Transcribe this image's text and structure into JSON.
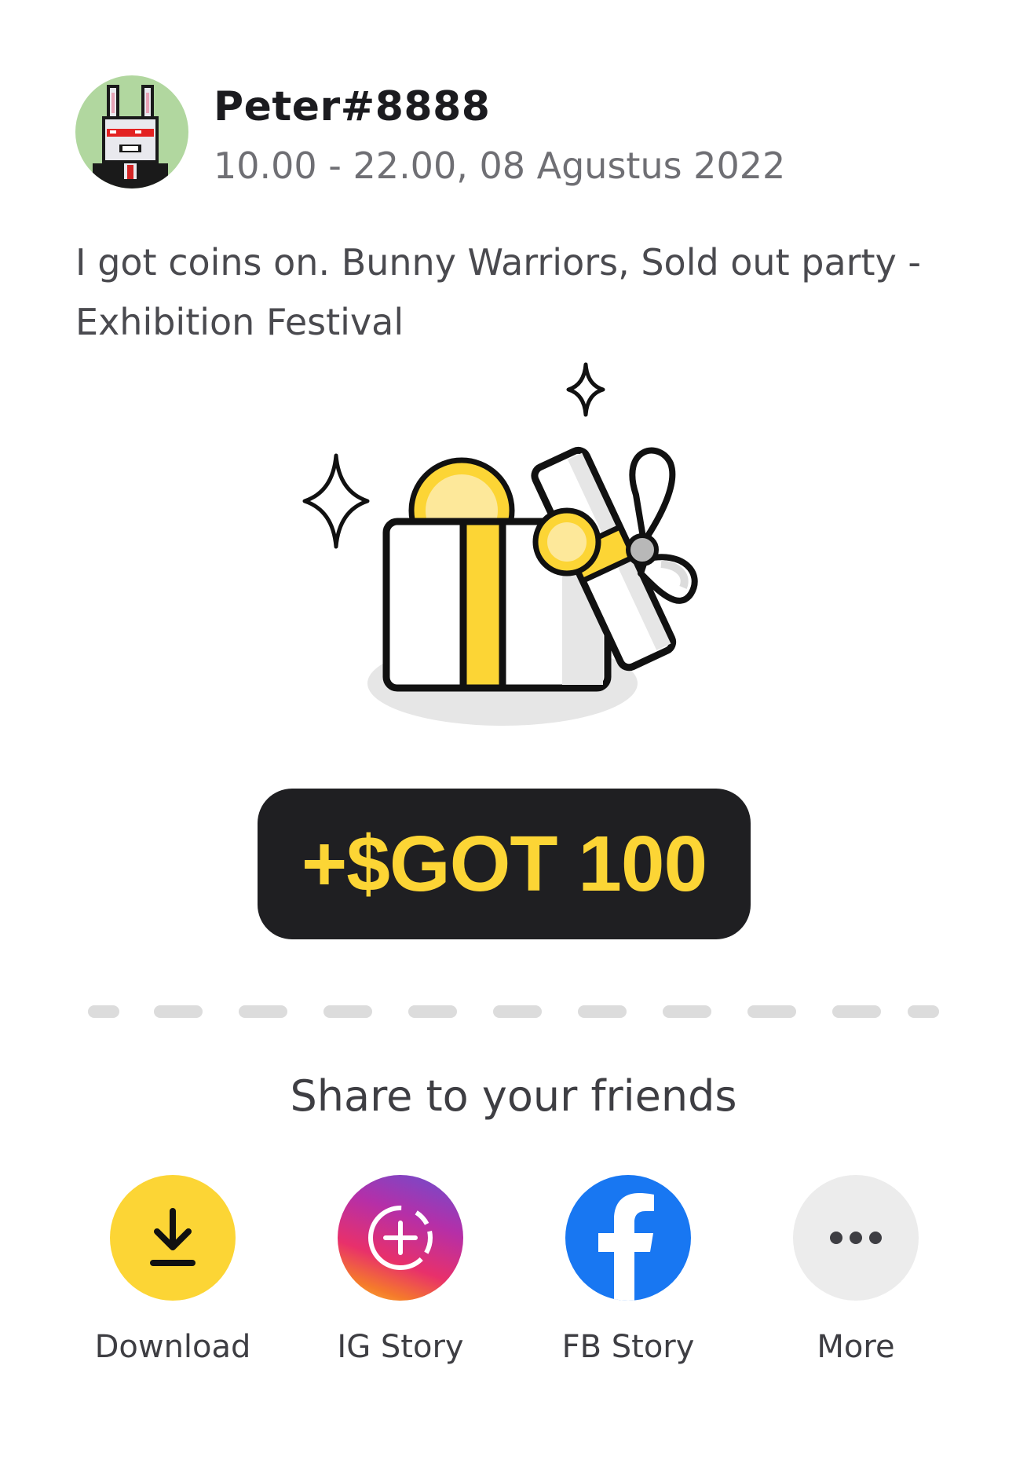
{
  "post": {
    "username": "Peter#8888",
    "datetime": "10.00 - 22.00, 08 Agustus 2022",
    "message": "I got coins on. Bunny Warriors, Sold out party - Exhibition Festival",
    "avatar_icon": "pixel-bunny-avatar"
  },
  "reward": {
    "label": "+$GOT 100"
  },
  "share": {
    "title": "Share to your friends",
    "options": [
      {
        "label": "Download",
        "icon": "download-icon",
        "color": "#fcd535"
      },
      {
        "label": "IG Story",
        "icon": "instagram-story-icon",
        "color": "#d8357a"
      },
      {
        "label": "FB Story",
        "icon": "facebook-icon",
        "color": "#1877f2"
      },
      {
        "label": "More",
        "icon": "more-icon",
        "color": "#ececec"
      }
    ]
  },
  "colors": {
    "accent_yellow": "#fcd535",
    "badge_dark": "#1f1f22",
    "avatar_bg": "#b1d79f"
  }
}
